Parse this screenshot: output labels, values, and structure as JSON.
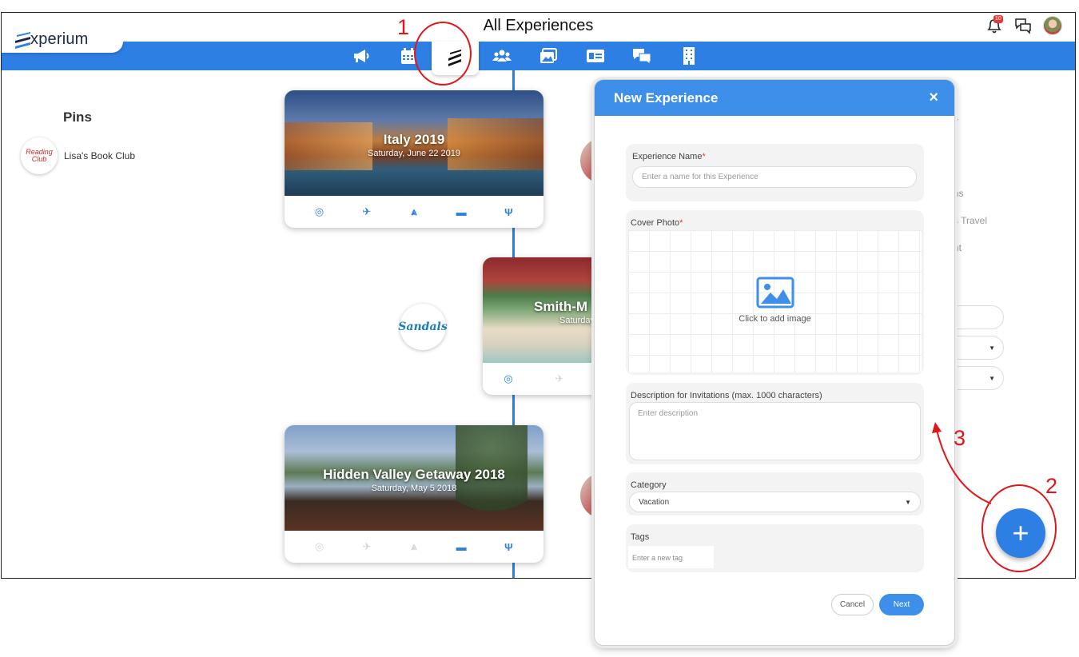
{
  "app": {
    "logo_text": "xperium",
    "page_title": "All Experiences",
    "notification_count": "10"
  },
  "nav": [
    {
      "name": "announcements",
      "icon": "megaphone-icon"
    },
    {
      "name": "calendar",
      "icon": "calendar-icon"
    },
    {
      "name": "experiences",
      "icon": "experium-logo-icon",
      "active": true
    },
    {
      "name": "groups",
      "icon": "users-icon"
    },
    {
      "name": "photos",
      "icon": "images-icon"
    },
    {
      "name": "contacts",
      "icon": "id-card-icon"
    },
    {
      "name": "chat",
      "icon": "chat-bubbles-icon"
    },
    {
      "name": "organization",
      "icon": "building-icon"
    }
  ],
  "pins": {
    "title": "Pins",
    "items": [
      {
        "label": "Lisa's Book Club",
        "logo_text": "Reading Club"
      }
    ]
  },
  "experiences": [
    {
      "title": "Italy 2019",
      "date": "Saturday, June 22 2019",
      "icons_active": [
        true,
        true,
        true,
        true,
        true
      ]
    },
    {
      "title": "Smith-M",
      "date": "Saturday",
      "icons_active": [
        true,
        false
      ]
    },
    {
      "title": "Hidden Valley Getaway 2018",
      "date": "Saturday, May 5 2018",
      "icons_active": [
        false,
        false,
        false,
        true,
        true
      ]
    }
  ],
  "partner_logo": "Sandals",
  "background_fragments": [
    "r",
    "ns",
    "s Travel",
    "nt"
  ],
  "modal": {
    "title": "New Experience",
    "close": "×",
    "experience_name_label": "Experience Name",
    "experience_name_placeholder": "Enter a name for this Experience",
    "cover_photo_label": "Cover Photo",
    "cover_photo_cta": "Click to add image",
    "description_label": "Description for Invitations (max. 1000 characters)",
    "description_placeholder": "Enter description",
    "category_label": "Category",
    "category_value": "Vacation",
    "tags_label": "Tags",
    "tags_placeholder": "Enter a new tag",
    "cancel_label": "Cancel",
    "next_label": "Next",
    "required_mark": "*"
  },
  "fab_label": "+",
  "annotations": [
    "1",
    "2",
    "3"
  ],
  "colors": {
    "primary": "#2e7fe3",
    "modal_header": "#3d8fe9",
    "annotation": "#e0161a"
  }
}
